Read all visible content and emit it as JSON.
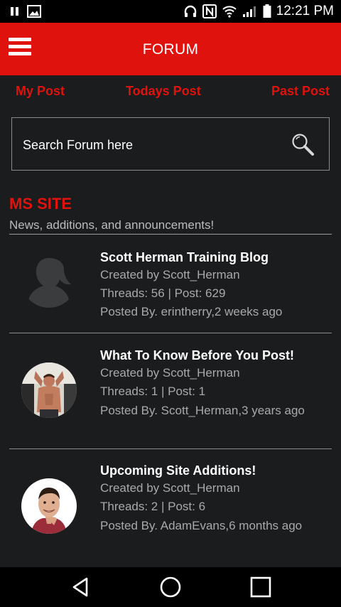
{
  "status_bar": {
    "time": "12:21 PM",
    "icons": [
      "pause-icon",
      "image-icon",
      "headset-icon",
      "nfc-icon",
      "wifi-icon",
      "signal-icon",
      "battery-icon"
    ]
  },
  "app_bar": {
    "title": "FORUM",
    "menu_icon": "hamburger-menu-icon"
  },
  "tabs": [
    {
      "label": "My Post"
    },
    {
      "label": "Todays Post"
    },
    {
      "label": "Past Post"
    }
  ],
  "search": {
    "placeholder": "Search Forum here",
    "icon": "search-icon"
  },
  "section": {
    "title": "MS SITE",
    "description": "News, additions, and announcements!"
  },
  "forums": [
    {
      "title": "Scott Herman Training Blog",
      "created_by": "Created by Scott_Herman",
      "stats": "Threads: 56 | Post: 629",
      "posted_by": "Posted By. erintherry,2 weeks ago",
      "avatar": "placeholder-silhouette-avatar"
    },
    {
      "title": "What To Know Before You Post!",
      "created_by": "Created by Scott_Herman",
      "stats": "Threads: 1 | Post: 1",
      "posted_by": "Posted By. Scott_Herman,3 years ago",
      "avatar": "fitness-man-photo-avatar"
    },
    {
      "title": "Upcoming Site Additions!",
      "created_by": "Created by Scott_Herman",
      "stats": "Threads: 2 | Post: 6",
      "posted_by": "Posted By. AdamEvans,6 months ago",
      "avatar": "smiling-man-photo-avatar"
    }
  ],
  "nav_bar": {
    "buttons": [
      "back-icon",
      "home-icon",
      "recents-icon"
    ]
  },
  "colors": {
    "accent": "#e0120e",
    "background": "#1b1c1e",
    "muted_text": "#a9a9a9"
  }
}
